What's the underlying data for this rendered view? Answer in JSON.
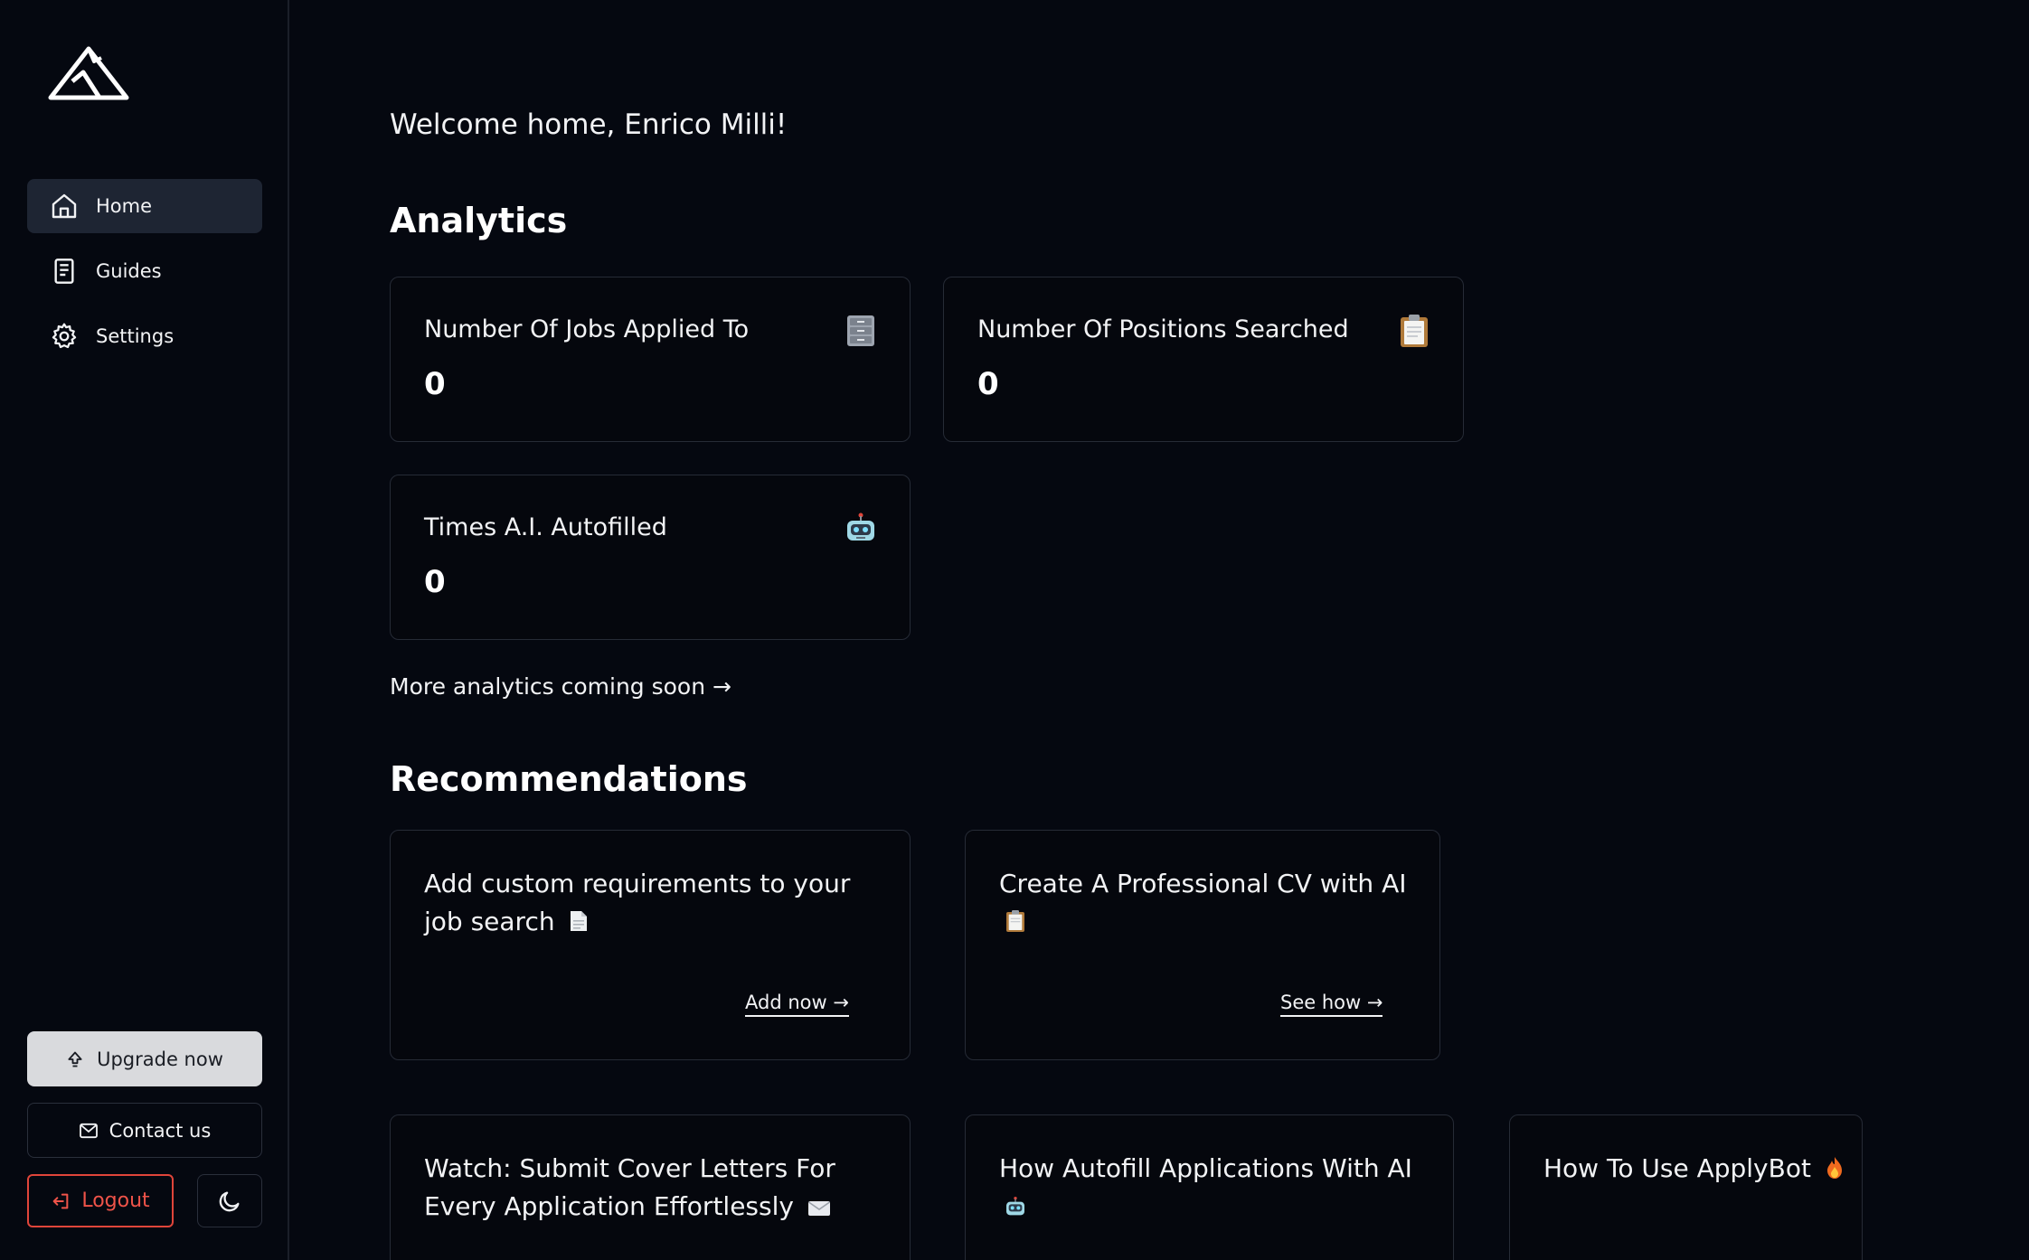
{
  "sidebar": {
    "nav": [
      {
        "label": "Home",
        "icon": "home-icon",
        "active": true
      },
      {
        "label": "Guides",
        "icon": "book-icon",
        "active": false
      },
      {
        "label": "Settings",
        "icon": "gear-icon",
        "active": false
      }
    ],
    "upgrade_label": "Upgrade now",
    "contact_label": "Contact us",
    "logout_label": "Logout"
  },
  "main": {
    "welcome": "Welcome home, Enrico Milli!",
    "analytics_title": "Analytics",
    "stats": [
      {
        "title": "Number Of Jobs Applied To",
        "value": "0",
        "icon": "file-cabinet-icon"
      },
      {
        "title": "Number Of Positions Searched",
        "value": "0",
        "icon": "clipboard-icon"
      },
      {
        "title": "Times A.I. Autofilled",
        "value": "0",
        "icon": "robot-icon"
      }
    ],
    "more_analytics": "More analytics coming soon →",
    "recommendations_title": "Recommendations",
    "recommendations": [
      {
        "title": "Add custom requirements to your job search",
        "icon": "document-icon",
        "action": "Add now →"
      },
      {
        "title": "Create A Professional CV with AI",
        "icon": "clipboard-icon",
        "action": "See how →"
      },
      {
        "title": "Watch: Submit Cover Letters For Every Application Effortlessly",
        "icon": "envelope-icon"
      },
      {
        "title": "How Autofill Applications With AI",
        "icon": "robot-icon"
      },
      {
        "title": "How To Use ApplyBot",
        "icon": "fire-icon"
      }
    ]
  },
  "colors": {
    "background": "#050810",
    "card_border": "#262b36",
    "active_nav": "#1e2533",
    "logout_red": "#e0453a"
  }
}
